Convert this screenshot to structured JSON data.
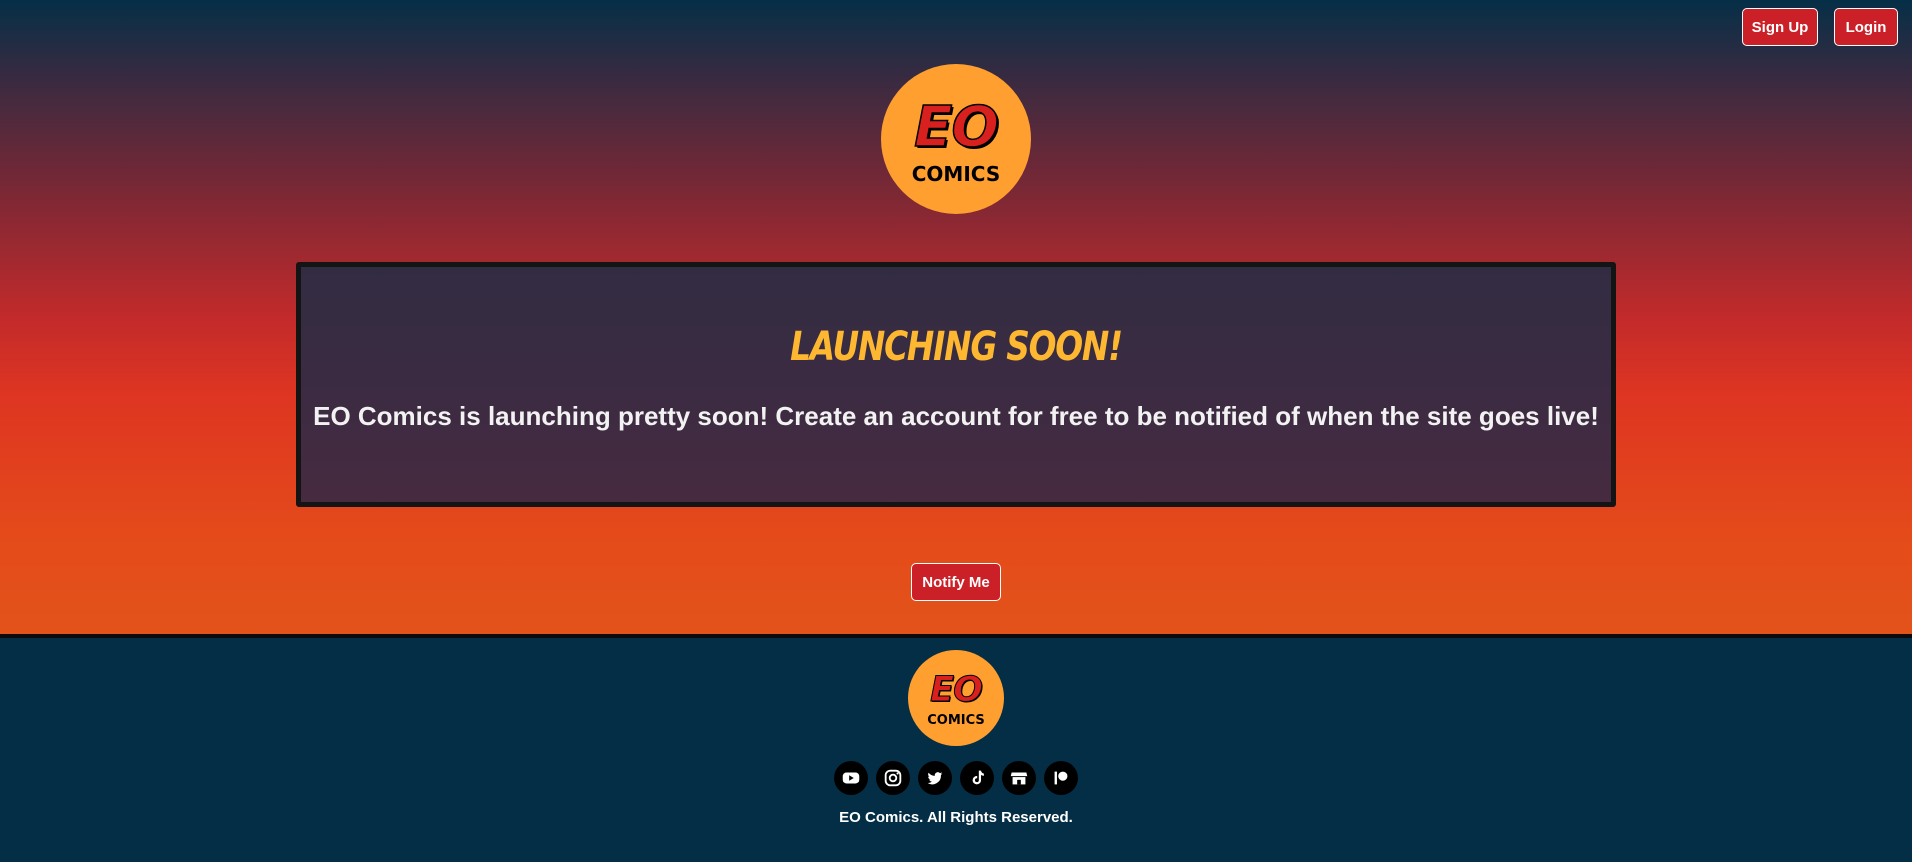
{
  "header": {
    "signup_label": "Sign Up",
    "login_label": "Login"
  },
  "logo": {
    "eo_text": "EO",
    "comics_text": "COMICS"
  },
  "card": {
    "title": "LAUNCHING SOON!",
    "text": "EO Comics is launching pretty soon! Create an account for free to be notified of when the site goes live!"
  },
  "notify": {
    "label": "Notify Me"
  },
  "footer": {
    "socials": [
      "youtube-icon",
      "instagram-icon",
      "twitter-icon",
      "tiktok-icon",
      "store-icon",
      "patreon-icon"
    ],
    "copyright": "EO Comics. All Rights Reserved."
  },
  "colors": {
    "accent_button": "#cb2027",
    "title_color": "#fdb731",
    "logo_bg": "#ff9f2f",
    "footer_bg": "#032e45"
  }
}
